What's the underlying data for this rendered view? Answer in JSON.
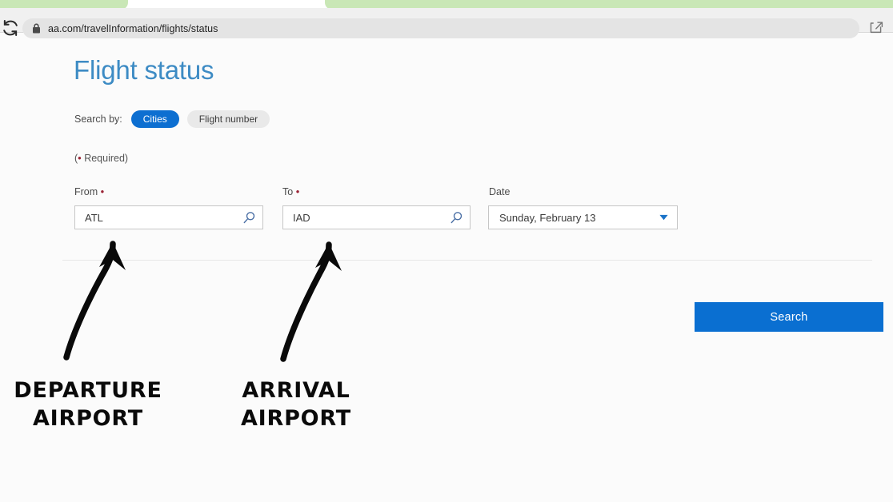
{
  "browser": {
    "url": "aa.com/travelInformation/flights/status",
    "reload_icon": "reload-icon",
    "lock_icon": "lock-icon",
    "share_icon": "share-icon"
  },
  "page": {
    "title": "Flight status",
    "search_by_label": "Search by:",
    "tabs": [
      {
        "label": "Cities",
        "active": true
      },
      {
        "label": "Flight number",
        "active": false
      }
    ],
    "required_prefix": "(",
    "required_bullet": "•",
    "required_text": " Required)",
    "fields": {
      "from": {
        "label": "From",
        "required_marker": "•",
        "value": "ATL",
        "icon": "magnifier-icon"
      },
      "to": {
        "label": "To",
        "required_marker": "•",
        "value": "IAD",
        "icon": "magnifier-icon"
      },
      "date": {
        "label": "Date",
        "value": "Sunday, February 13",
        "icon": "chevron-down-icon"
      }
    },
    "search_button_label": "Search"
  },
  "annotations": [
    {
      "text": "DEPARTURE\nAIRPORT",
      "target": "from-field"
    },
    {
      "text": "ARRIVAL\nAIRPORT",
      "target": "to-field"
    }
  ],
  "colors": {
    "accent_blue": "#0a6fd1",
    "title_blue": "#3d8bc4",
    "required_red": "#9b2335",
    "tab_green": "#c9e7b6",
    "page_bg": "#fbfbfb"
  }
}
